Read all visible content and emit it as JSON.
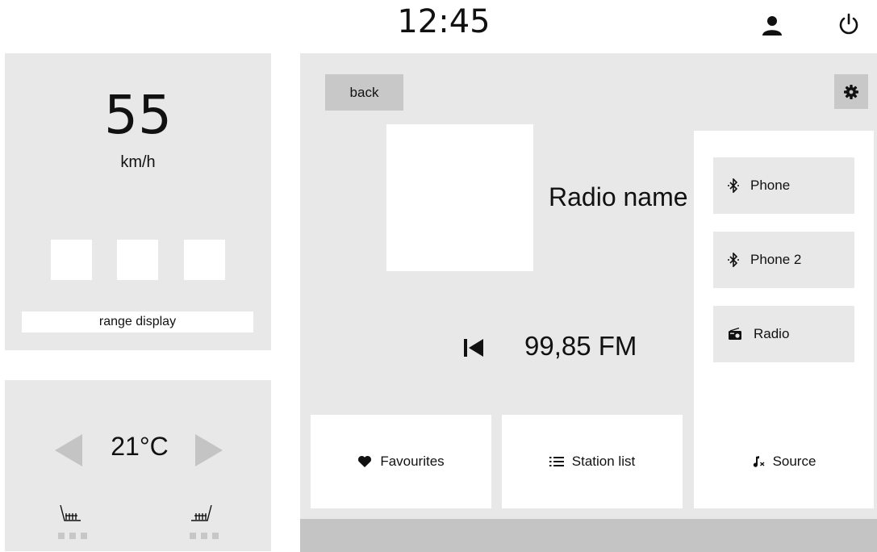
{
  "header": {
    "clock": "12:45",
    "user_icon": "user-icon",
    "power_icon": "power-icon"
  },
  "cluster": {
    "speed": "55",
    "speed_unit": "km/h",
    "range_label": "range display"
  },
  "climate": {
    "temperature": "21°C",
    "left_arrow_icon": "triangle-left-icon",
    "right_arrow_icon": "triangle-right-icon",
    "seat_heater_left_icon": "seat-heater-left-icon",
    "seat_heater_right_icon": "seat-heater-right-icon"
  },
  "media": {
    "back_label": "back",
    "settings_icon": "gear-icon",
    "station_name": "Radio name",
    "frequency": "99,85 FM",
    "previous_icon": "skip-previous-icon",
    "bottom_buttons": [
      {
        "label": "Favourites",
        "icon": "heart-icon"
      },
      {
        "label": "Station list",
        "icon": "list-icon"
      },
      {
        "label": "Source",
        "icon": "music-source-icon"
      }
    ],
    "source_menu": [
      {
        "label": "Phone",
        "icon": "bluetooth-icon"
      },
      {
        "label": "Phone 2",
        "icon": "bluetooth-icon"
      },
      {
        "label": "Radio",
        "icon": "radio-icon"
      }
    ]
  },
  "colors": {
    "panel_bg": "#e8e8e8",
    "button_grey": "#c8c8c8",
    "arrow_grey": "#c4c4c4",
    "text": "#111111"
  }
}
